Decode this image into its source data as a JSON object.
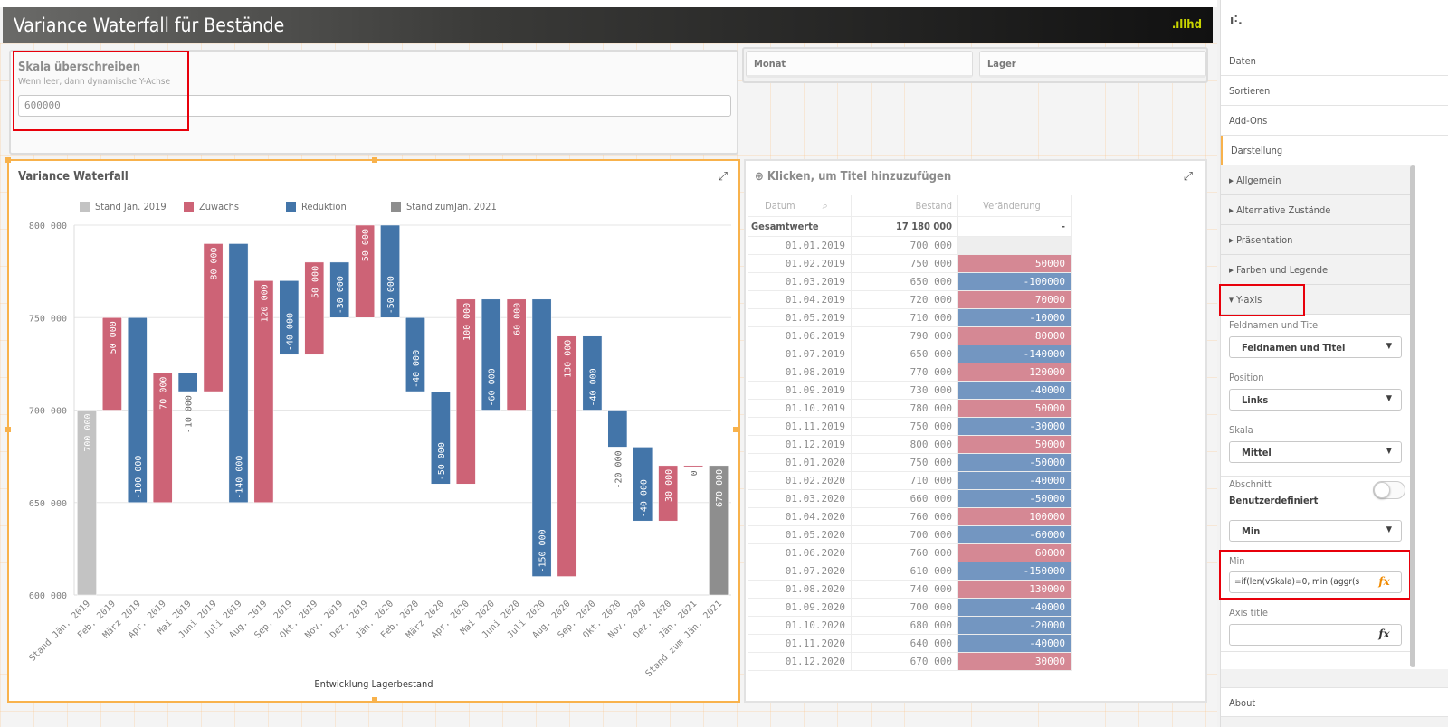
{
  "header": {
    "title": "Variance Waterfall für Bestände",
    "logo": ".ıllhd"
  },
  "filter": {
    "title": "Skala überschreiben",
    "subtitle": "Wenn leer, dann dynamische Y-Achse",
    "value": "600000"
  },
  "listboxes": [
    {
      "label": "Monat"
    },
    {
      "label": "Lager"
    }
  ],
  "chart_panel": {
    "title": "Variance Waterfall"
  },
  "chart_data": {
    "type": "waterfall",
    "title": "Variance Waterfall",
    "xlabel": "Entwicklung Lagerbestand",
    "ylabel": "",
    "ylim": [
      600000,
      800000
    ],
    "yticks": [
      600000,
      650000,
      700000,
      750000,
      800000
    ],
    "ytick_labels": [
      "600 000",
      "650 000",
      "700 000",
      "750 000",
      "800 000"
    ],
    "grid": true,
    "legend_position": "top",
    "legend": [
      {
        "name": "Stand Jän. 2019",
        "color": "#c3c3c3"
      },
      {
        "name": "Zuwachs",
        "color": "#cd6376"
      },
      {
        "name": "Reduktion",
        "color": "#4375a9"
      },
      {
        "name": "Stand zumJän. 2021",
        "color": "#8e8e8e"
      }
    ],
    "categories": [
      "Stand Jän. 2019",
      "Feb. 2019",
      "März 2019",
      "Apr. 2019",
      "Mai 2019",
      "Juni 2019",
      "Juli 2019",
      "Aug. 2019",
      "Sep. 2019",
      "Okt. 2019",
      "Nov. 2019",
      "Dez. 2019",
      "Jän. 2020",
      "Feb. 2020",
      "März 2020",
      "Apr. 2020",
      "Mai 2020",
      "Juni 2020",
      "Juli 2020",
      "Aug. 2020",
      "Sep. 2020",
      "Okt. 2020",
      "Nov. 2020",
      "Dez. 2020",
      "Jän. 2021",
      "Stand zum Jän. 2021"
    ],
    "start_value": 700000,
    "changes": [
      50000,
      -100000,
      70000,
      -10000,
      80000,
      -140000,
      120000,
      -40000,
      50000,
      -30000,
      50000,
      -50000,
      -40000,
      -50000,
      100000,
      -60000,
      60000,
      -150000,
      130000,
      -40000,
      -20000,
      -40000,
      30000,
      0
    ],
    "end_value": 670000,
    "data_labels": [
      "700 000",
      "50 000",
      "-100 000",
      "70 000",
      "-10 000",
      "80 000",
      "-140 000",
      "120 000",
      "-40 000",
      "50 000",
      "-30 000",
      "50 000",
      "-50 000",
      "-40 000",
      "-50 000",
      "100 000",
      "-60 000",
      "60 000",
      "-150 000",
      "130 000",
      "-40 000",
      "-20 000",
      "-40 000",
      "30 000",
      "0",
      "670 000"
    ]
  },
  "table": {
    "title": "Klicken, um Titel hinzuzufügen",
    "columns": [
      "Datum",
      "Bestand",
      "Veränderung"
    ],
    "totals": {
      "label": "Gesamtwerte",
      "bestand": "17 180 000",
      "veraenderung": "-"
    },
    "rows": [
      {
        "d": "01.01.2019",
        "b": "700 000",
        "v": ""
      },
      {
        "d": "01.02.2019",
        "b": "750 000",
        "v": "50000"
      },
      {
        "d": "01.03.2019",
        "b": "650 000",
        "v": "-100000"
      },
      {
        "d": "01.04.2019",
        "b": "720 000",
        "v": "70000"
      },
      {
        "d": "01.05.2019",
        "b": "710 000",
        "v": "-10000"
      },
      {
        "d": "01.06.2019",
        "b": "790 000",
        "v": "80000"
      },
      {
        "d": "01.07.2019",
        "b": "650 000",
        "v": "-140000"
      },
      {
        "d": "01.08.2019",
        "b": "770 000",
        "v": "120000"
      },
      {
        "d": "01.09.2019",
        "b": "730 000",
        "v": "-40000"
      },
      {
        "d": "01.10.2019",
        "b": "780 000",
        "v": "50000"
      },
      {
        "d": "01.11.2019",
        "b": "750 000",
        "v": "-30000"
      },
      {
        "d": "01.12.2019",
        "b": "800 000",
        "v": "50000"
      },
      {
        "d": "01.01.2020",
        "b": "750 000",
        "v": "-50000"
      },
      {
        "d": "01.02.2020",
        "b": "710 000",
        "v": "-40000"
      },
      {
        "d": "01.03.2020",
        "b": "660 000",
        "v": "-50000"
      },
      {
        "d": "01.04.2020",
        "b": "760 000",
        "v": "100000"
      },
      {
        "d": "01.05.2020",
        "b": "700 000",
        "v": "-60000"
      },
      {
        "d": "01.06.2020",
        "b": "760 000",
        "v": "60000"
      },
      {
        "d": "01.07.2020",
        "b": "610 000",
        "v": "-150000"
      },
      {
        "d": "01.08.2020",
        "b": "740 000",
        "v": "130000"
      },
      {
        "d": "01.09.2020",
        "b": "700 000",
        "v": "-40000"
      },
      {
        "d": "01.10.2020",
        "b": "680 000",
        "v": "-20000"
      },
      {
        "d": "01.11.2020",
        "b": "640 000",
        "v": "-40000"
      },
      {
        "d": "01.12.2020",
        "b": "670 000",
        "v": "30000"
      }
    ]
  },
  "side": {
    "tabs": [
      "Daten",
      "Sortieren",
      "Add-Ons",
      "Darstellung"
    ],
    "sections": [
      "Allgemein",
      "Alternative Zustände",
      "Präsentation",
      "Farben und Legende",
      "Y-axis"
    ],
    "fields": {
      "feldnamen_label": "Feldnamen und Titel",
      "feldnamen_value": "Feldnamen und Titel",
      "position_label": "Position",
      "position_value": "Links",
      "skala_label": "Skala",
      "skala_value": "Mittel",
      "abschnitt_label": "Abschnitt",
      "abschnitt_value": "Benutzerdefiniert",
      "abschnitt_toggle_on": false,
      "minmax_value": "Min",
      "min_label": "Min",
      "min_expr": "=if(len(vSkala)=0, min (aggr(s",
      "axis_title_label": "Axis title",
      "axis_title_value": "",
      "fx": "fx"
    },
    "about": "About"
  },
  "colors": {
    "accent": "#f8b24c",
    "highlight": "#e8000b",
    "zuwachs": "#cd6376",
    "reduktion": "#4375a9"
  }
}
